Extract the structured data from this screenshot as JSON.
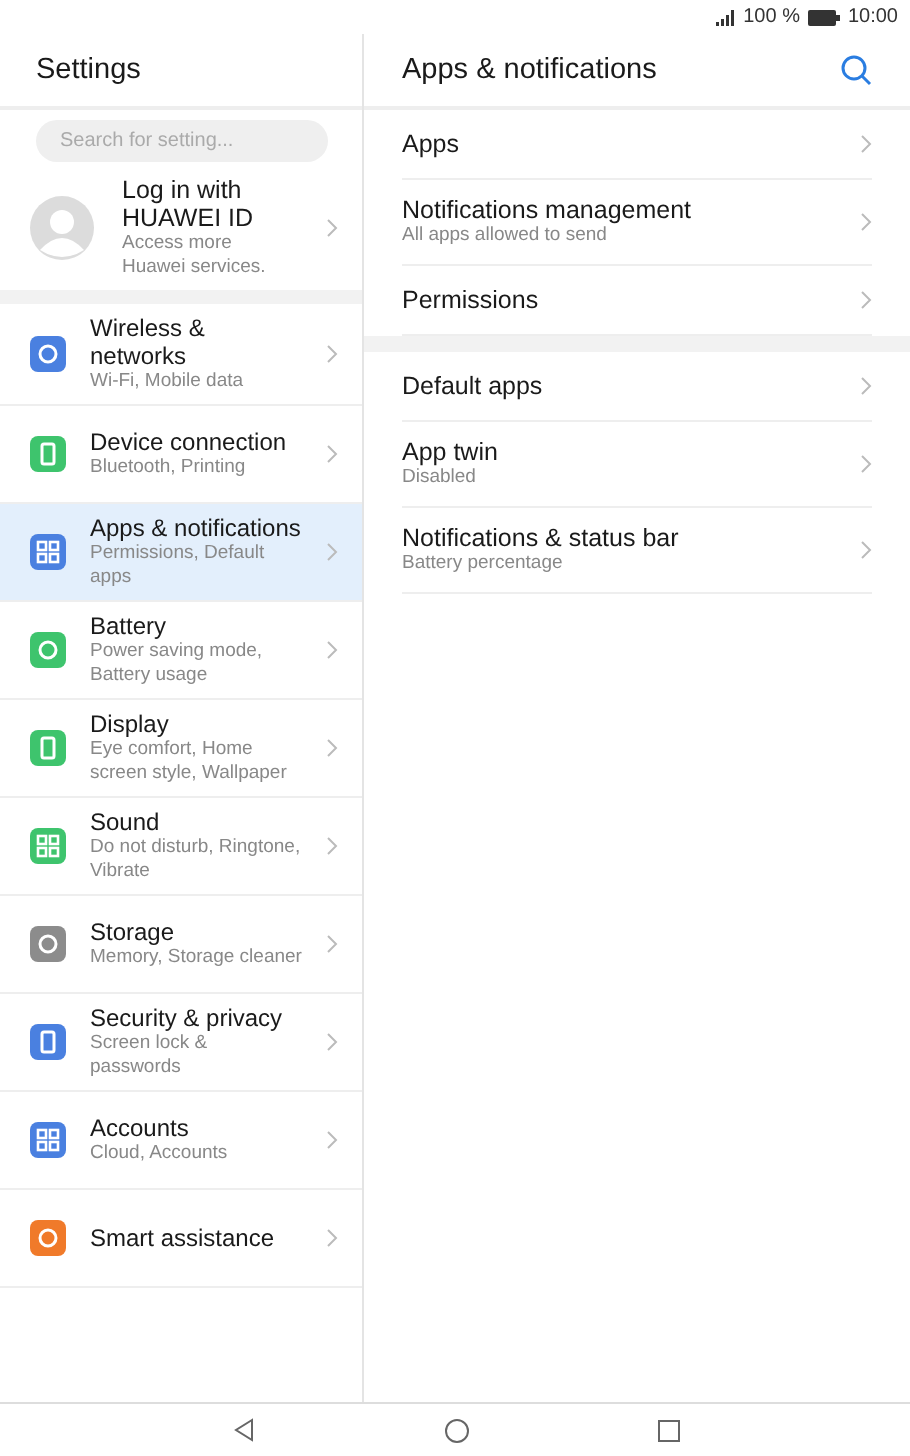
{
  "status_bar": {
    "battery_text": "100 %",
    "time": "10:00"
  },
  "left": {
    "title": "Settings",
    "search": {
      "placeholder": "Search for setting..."
    },
    "account": {
      "title": "Log in with HUAWEI ID",
      "subtitle": "Access more Huawei services."
    },
    "items": [
      {
        "title": "Wireless & networks",
        "subtitle": "Wi-Fi, Mobile data",
        "color": "#4a80e0",
        "selected": false
      },
      {
        "title": "Device connection",
        "subtitle": "Bluetooth, Printing",
        "color": "#3ec46d",
        "selected": false
      },
      {
        "title": "Apps & notifications",
        "subtitle": "Permissions, Default apps",
        "color": "#4a80e0",
        "selected": true
      },
      {
        "title": "Battery",
        "subtitle": "Power saving mode, Battery usage",
        "color": "#3ec46d",
        "selected": false
      },
      {
        "title": "Display",
        "subtitle": "Eye comfort, Home screen style, Wallpaper",
        "color": "#3ec46d",
        "selected": false
      },
      {
        "title": "Sound",
        "subtitle": "Do not disturb, Ringtone, Vibrate",
        "color": "#3ec46d",
        "selected": false
      },
      {
        "title": "Storage",
        "subtitle": "Memory, Storage cleaner",
        "color": "#8c8c8c",
        "selected": false
      },
      {
        "title": "Security & privacy",
        "subtitle": "Screen lock & passwords",
        "color": "#4a80e0",
        "selected": false
      },
      {
        "title": "Accounts",
        "subtitle": "Cloud, Accounts",
        "color": "#4a80e0",
        "selected": false
      },
      {
        "title": "Smart assistance",
        "color": "#f07a2a",
        "selected": false
      }
    ]
  },
  "right": {
    "title": "Apps & notifications",
    "groups": [
      [
        {
          "title": "Apps"
        },
        {
          "title": "Notifications management",
          "subtitle": "All apps allowed to send"
        },
        {
          "title": "Permissions"
        }
      ],
      [
        {
          "title": "Default apps"
        },
        {
          "title": "App twin",
          "subtitle": "Disabled"
        },
        {
          "title": "Notifications & status bar",
          "subtitle": "Battery percentage"
        }
      ]
    ]
  }
}
